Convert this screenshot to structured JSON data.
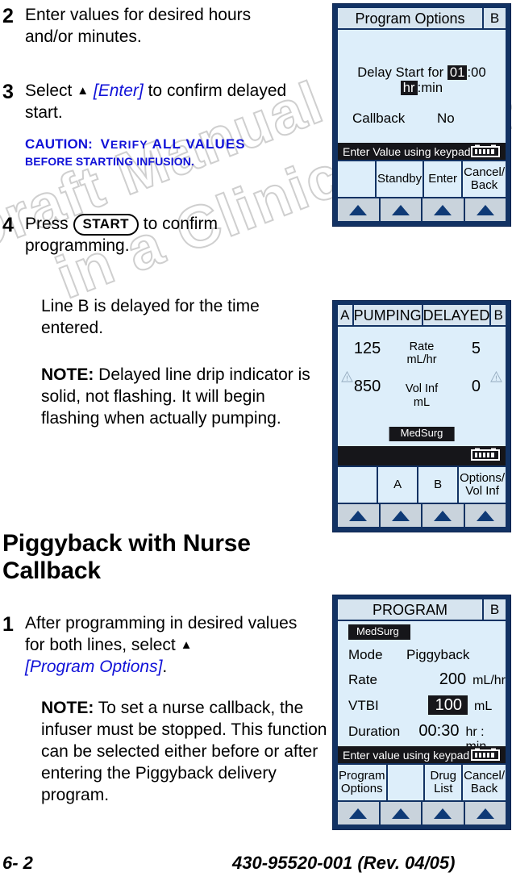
{
  "watermark": {
    "line1": "Draft Manual Not to be used",
    "line2": "in a Clinical Situation."
  },
  "footer": {
    "page": "6- 2",
    "doc_id": "430-95520-001 (Rev. 04/05)"
  },
  "steps": {
    "step2": {
      "number": "2",
      "text": "Enter values for desired hours and/or minutes."
    },
    "step3": {
      "number": "3",
      "text_before": "Select ",
      "triangle": "▲",
      "link": " [Enter]",
      "text_after": " to confirm delayed start.",
      "caution_label": "CAUTION:",
      "caution_text_1": "V",
      "caution_text_2": "ERIFY",
      "caution_text_3": "ALL VALUES",
      "caution_text_4": "BEFORE STARTING INFUSION."
    },
    "step4": {
      "number": "4",
      "text_before": "Press ",
      "button": "START",
      "text_after": " to confirm programming.",
      "para1": "Line B is delayed for the time entered.",
      "note_label": "NOTE:",
      "note_text": " Delayed line drip indicator is solid, not flashing. It will begin flashing when actually pumping."
    }
  },
  "section": {
    "title": "Piggyback with Nurse Callback",
    "step1": {
      "number": "1",
      "text_before": "After programming in desired values for both lines, select ",
      "triangle": "▲",
      "link": "[Program Options]",
      "text_after": ".",
      "note_label": "NOTE:",
      "note_text": " To set a nurse callback, the infuser must be stopped. This function can be selected either before or after entering the Piggyback delivery program."
    }
  },
  "device1": {
    "header": {
      "title": "Program Options",
      "side": "B"
    },
    "delay": {
      "label_before": "Delay Start for",
      "hours": "01",
      "sep": ":",
      "minutes": "00",
      "unit_hl": "hr",
      "unit_rest": ":min"
    },
    "callback": {
      "label": "Callback",
      "value": "No"
    },
    "status": "Enter Value using keypad",
    "softkeys": [
      "",
      "Standby",
      "Enter",
      "Cancel/\nBack"
    ],
    "softkey_labels": {
      "k1": "",
      "k2": "Standby",
      "k3": "Enter",
      "k4_line1": "Cancel/",
      "k4_line2": "Back"
    }
  },
  "device2": {
    "header": {
      "a": "A",
      "pumping": "PUMPING",
      "delayed": "DELAYED",
      "b": "B"
    },
    "rows": [
      {
        "left": "125",
        "label_line1": "Rate",
        "label_line2": "mL/hr",
        "right": "5"
      },
      {
        "left": "850",
        "label_line1": "Vol Inf",
        "label_line2": "mL",
        "right": "0"
      }
    ],
    "badge": "MedSurg",
    "status": "",
    "softkey_labels": {
      "k1": "",
      "k2": "A",
      "k3": "B",
      "k4_line1": "Options/",
      "k4_line2": "Vol Inf"
    }
  },
  "device3": {
    "header": {
      "title": "PROGRAM",
      "side": "B"
    },
    "badge": "MedSurg",
    "rows": [
      {
        "key": "Mode",
        "value": "Piggyback",
        "unit": ""
      },
      {
        "key": "Rate",
        "value": "200",
        "unit": "mL/hr"
      },
      {
        "key": "VTBI",
        "value": "100",
        "unit": "mL"
      },
      {
        "key": "Duration",
        "value": "00:30",
        "unit": "hr : min"
      }
    ],
    "status": "Enter value using keypad",
    "softkey_labels": {
      "k1_line1": "Program",
      "k1_line2": "Options",
      "k2": "",
      "k3_line1": "Drug",
      "k3_line2": "List",
      "k4_line1": "Cancel/",
      "k4_line2": "Back"
    }
  },
  "colors": {
    "bezel": "#123263",
    "screen": "#ddeefa",
    "header_cell": "#d6e4ef",
    "status_bar": "#16161a",
    "softkey": "#c9d3dc",
    "arrow": "#0f3a76",
    "link_blue": "#1112d8"
  }
}
